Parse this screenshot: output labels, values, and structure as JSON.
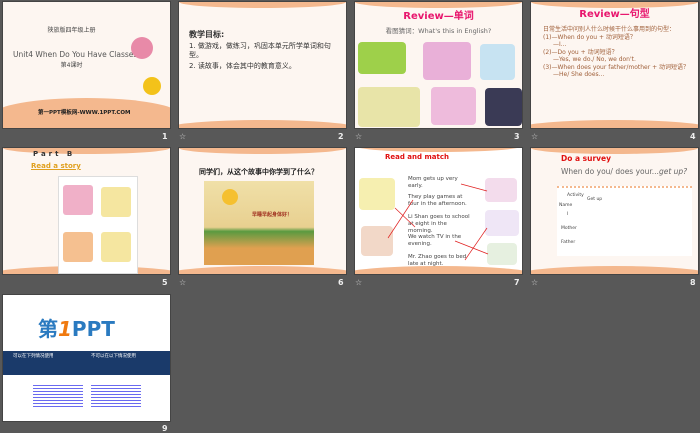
{
  "slides": [
    {
      "num": "1",
      "grade": "陕旅版四年级上册",
      "title": "Unit4 When Do You Have Classes?",
      "lesson": "第4课时",
      "footer": "第一PPT模板网-WWW.1PPT.COM"
    },
    {
      "num": "2",
      "heading": "教学目标:",
      "lines": [
        "1. 做游戏，做练习，巩固本单元所学单词和句型。",
        "2. 读故事，体会其中的教育意义。"
      ]
    },
    {
      "num": "3",
      "title": "Review—单词",
      "subtitle": "看图猜词：What's this in English?"
    },
    {
      "num": "4",
      "title": "Review—句型",
      "lines": [
        "日常生活中问别人什么时候干什么事用到的句型：",
        "(1)—When do you + 动词短语？",
        "—I...",
        "(2)—Do you + 动词短语？",
        "—Yes, we do./ No, we don't.",
        "(3)—When does your father/mother + 动词短语？",
        "—He/ She does..."
      ]
    },
    {
      "num": "5",
      "part": "Part B",
      "title": "Read a story"
    },
    {
      "num": "6",
      "title": "同学们，从这个故事中你学到了什么？",
      "caption": "早睡早起身体好！"
    },
    {
      "num": "7",
      "title": "Read and match",
      "sentences": [
        "Mom gets up very early.",
        "They play games at four in the afternoon.",
        "Li Shan goes to school at eight in the morning.",
        "We watch TV in the evening.",
        "Mr. Zhao goes to bed late at night."
      ]
    },
    {
      "num": "8",
      "title": "Do a survey",
      "question_prefix": "When do you/ does your...",
      "question_em": "get up?",
      "table": {
        "activity": "Activity",
        "name": "Name",
        "col": "Get up",
        "rows": [
          "I",
          "Mother",
          "Father"
        ]
      }
    },
    {
      "num": "9",
      "logo_a": "第",
      "logo_b": "1",
      "logo_c": "PPT",
      "left_head": "可以在下列情况使用",
      "right_head": "不可以在以下情况使用"
    }
  ],
  "star_icon": "☆"
}
